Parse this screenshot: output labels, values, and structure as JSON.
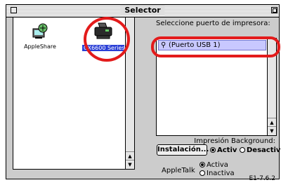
{
  "window": {
    "title": "Selector"
  },
  "devices": [
    {
      "label": "AppleShare",
      "icon": "appleshare-icon",
      "selected": false
    },
    {
      "label": "CX6600 Series",
      "icon": "printer-icon",
      "selected": true
    }
  ],
  "port": {
    "title": "Seleccione puerto de impresora:",
    "items": [
      {
        "label": "(Puerto USB 1)",
        "icon": "usb-icon",
        "selected": true
      }
    ]
  },
  "background_printing": {
    "label": "Impresión Background:",
    "setup_button": "Instalación...",
    "on_label": "Activ",
    "off_label": "Desactiv",
    "selected": "on"
  },
  "appletalk": {
    "label": "AppleTalk",
    "on_label": "Activa",
    "off_label": "Inactiva",
    "selected": "on"
  },
  "version": "E1-7.6.2",
  "colors": {
    "highlight": "#c8c8ff",
    "selected_label": "#2a3fd6",
    "annotation_ring": "#e31b1b"
  }
}
